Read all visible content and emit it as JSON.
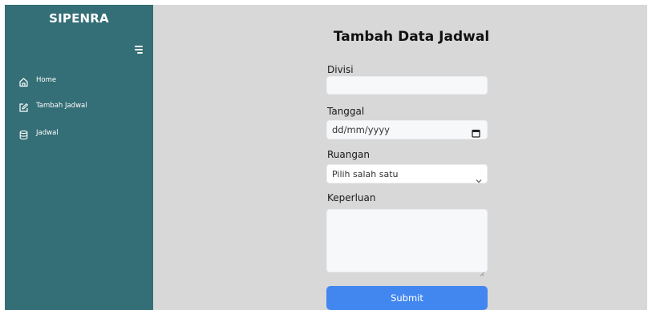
{
  "sidebar": {
    "brand": "SIPENRA",
    "items": [
      {
        "label": "Home",
        "icon": "home-icon"
      },
      {
        "label": "Tambah Jadwal",
        "icon": "edit-icon"
      },
      {
        "label": "Jadwal",
        "icon": "database-icon"
      }
    ]
  },
  "form": {
    "title": "Tambah Data Jadwal",
    "divisi_label": "Divisi",
    "divisi_value": "",
    "tanggal_label": "Tanggal",
    "tanggal_placeholder": "dd/mm/yyyy",
    "ruangan_label": "Ruangan",
    "ruangan_selected": "Pilih salah satu",
    "keperluan_label": "Keperluan",
    "keperluan_value": "",
    "submit_label": "Submit"
  },
  "colors": {
    "sidebar_bg": "#346e76",
    "main_bg": "#d8d8d8",
    "submit_bg": "#4287f0"
  }
}
